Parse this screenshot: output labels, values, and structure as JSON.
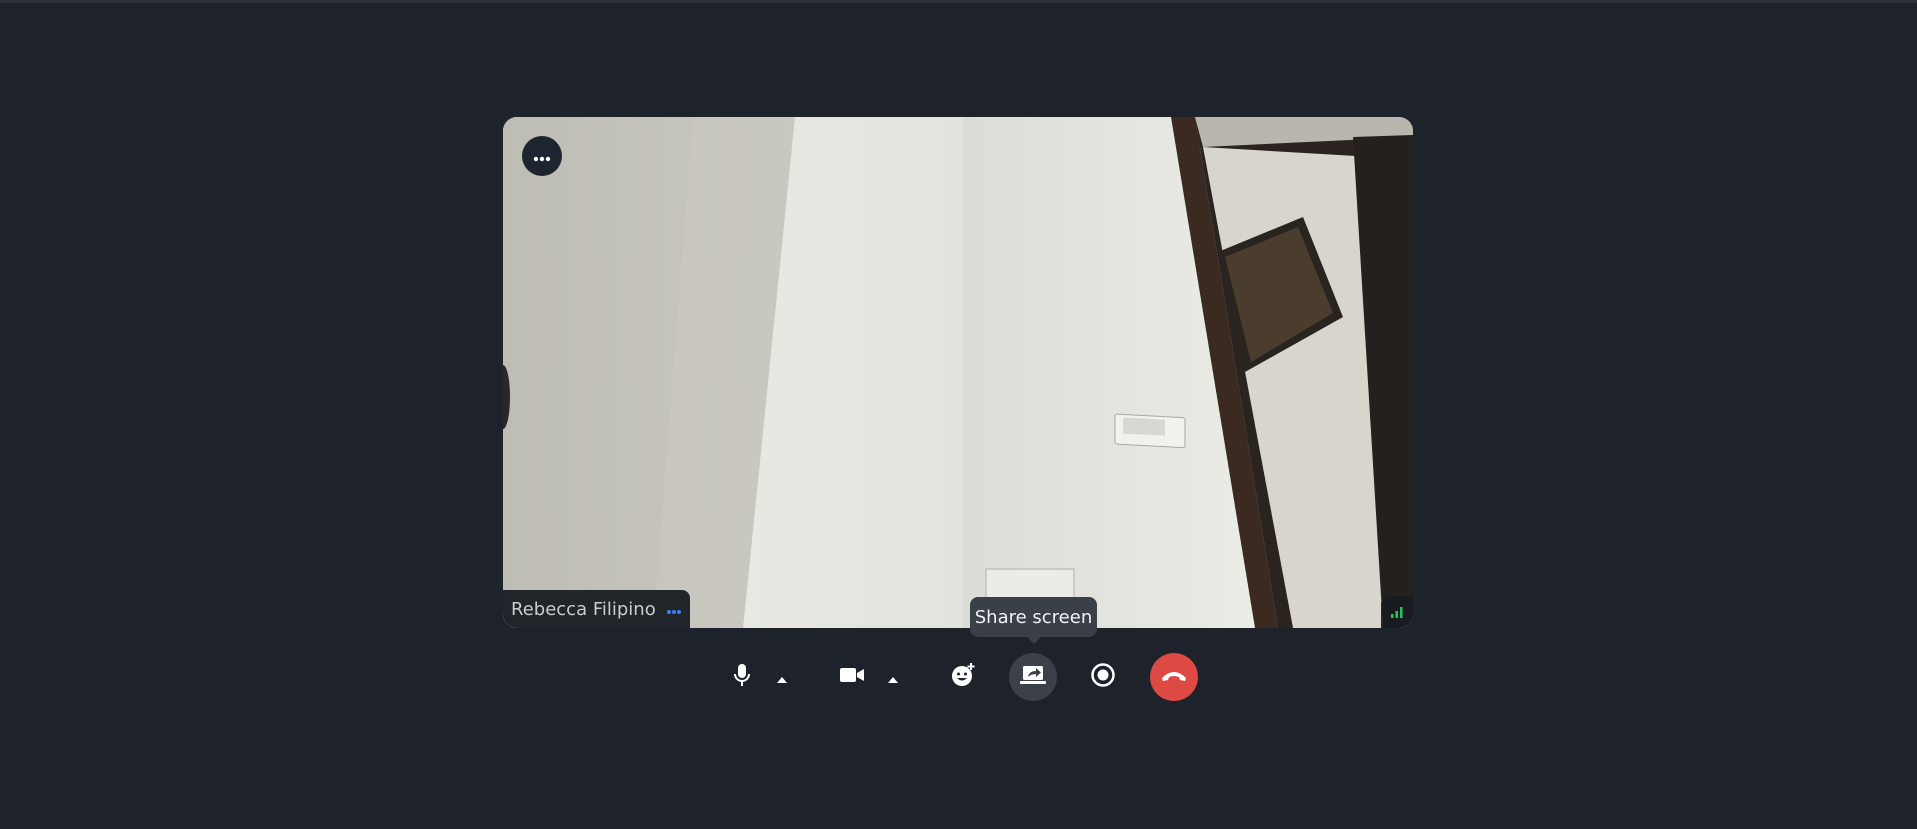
{
  "participant": {
    "name": "Rebecca Filipino"
  },
  "tooltip": {
    "text": "Share screen"
  },
  "toolbar": {
    "buttons": [
      {
        "name": "microphone",
        "icon": "microphone-icon"
      },
      {
        "name": "microphone-options",
        "icon": "caret-up-icon"
      },
      {
        "name": "camera",
        "icon": "video-camera-icon"
      },
      {
        "name": "camera-options",
        "icon": "caret-up-icon"
      },
      {
        "name": "reactions",
        "icon": "emoji-add-icon"
      },
      {
        "name": "share-screen",
        "icon": "share-screen-icon"
      },
      {
        "name": "record",
        "icon": "record-icon"
      },
      {
        "name": "leave-call",
        "icon": "phone-hangup-icon"
      }
    ]
  },
  "colors": {
    "background": "#1e222b",
    "hangup": "#dd4a43",
    "accent_dots": "#3b82f6",
    "signal": "#22c55e"
  }
}
